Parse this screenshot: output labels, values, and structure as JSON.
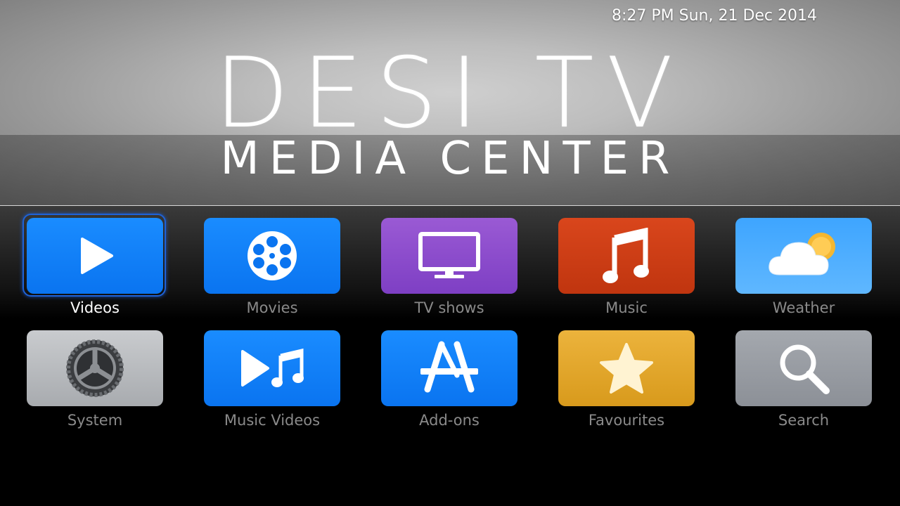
{
  "header": {
    "clock": "8:27 PM Sun, 21 Dec 2014",
    "logo_line1": "DESI TV",
    "logo_line2": "MEDIA CENTER"
  },
  "menu": {
    "row1": [
      {
        "label": "Videos",
        "icon": "play-icon",
        "color": "#0a74f0",
        "selected": true
      },
      {
        "label": "Movies",
        "icon": "film-reel-icon",
        "color": "#0a74f0"
      },
      {
        "label": "TV shows",
        "icon": "tv-monitor-icon",
        "color": "#8a4bcc"
      },
      {
        "label": "Music",
        "icon": "music-note-icon",
        "color": "#c9390f"
      },
      {
        "label": "Weather",
        "icon": "cloud-sun-icon",
        "color": "#4aadff"
      }
    ],
    "row2": [
      {
        "label": "System",
        "icon": "gear-icon",
        "color": "#b5b8bc"
      },
      {
        "label": "Music Videos",
        "icon": "play-music-icon",
        "color": "#0a74f0"
      },
      {
        "label": "Add-ons",
        "icon": "app-store-icon",
        "color": "#0a74f0"
      },
      {
        "label": "Favourites",
        "icon": "star-icon",
        "color": "#e2a52a"
      },
      {
        "label": "Search",
        "icon": "magnifier-icon",
        "color": "#979ba1"
      }
    ]
  }
}
